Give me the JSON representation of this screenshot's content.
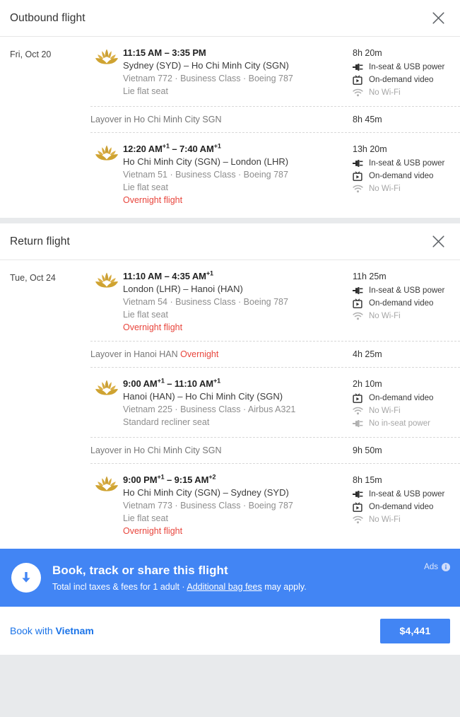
{
  "cards": [
    {
      "title": "Outbound flight",
      "close_icon": "close-icon",
      "date": "Fri, Oct 20",
      "rows": [
        {
          "kind": "segment",
          "logo": "vietnam-airlines-lotus-logo",
          "times": "11:15 AM – 3:35 PM",
          "times_plain": "11:15 AM – 3:35 PM",
          "dep_sup": "",
          "arr_sup": "",
          "route": "Sydney (SYD) – Ho Chi Minh City (SGN)",
          "meta": "Vietnam 772 · Business Class · Boeing 787",
          "seat": "Lie flat seat",
          "overnight": "",
          "duration": "8h 20m",
          "amenities": [
            {
              "icon": "power-plug-icon",
              "label": "In-seat & USB power",
              "available": true
            },
            {
              "icon": "on-demand-video-icon",
              "label": "On-demand video",
              "available": true
            },
            {
              "icon": "wifi-icon",
              "label": "No Wi-Fi",
              "available": false
            }
          ]
        },
        {
          "kind": "layover",
          "text": "Layover in Ho Chi Minh City SGN",
          "overnight": "",
          "duration": "8h 45m"
        },
        {
          "kind": "segment",
          "logo": "vietnam-airlines-lotus-logo",
          "times_plain": "12:20 AM – 7:40 AM",
          "dep_time": "12:20 AM",
          "dep_sup": "+1",
          "arr_time": "7:40 AM",
          "arr_sup": "+1",
          "route": "Ho Chi Minh City (SGN) – London (LHR)",
          "meta": "Vietnam 51 · Business Class · Boeing 787",
          "seat": "Lie flat seat",
          "overnight": "Overnight flight",
          "duration": "13h 20m",
          "amenities": [
            {
              "icon": "power-plug-icon",
              "label": "In-seat & USB power",
              "available": true
            },
            {
              "icon": "on-demand-video-icon",
              "label": "On-demand video",
              "available": true
            },
            {
              "icon": "wifi-icon",
              "label": "No Wi-Fi",
              "available": false
            }
          ]
        }
      ]
    },
    {
      "title": "Return flight",
      "close_icon": "close-icon",
      "date": "Tue, Oct 24",
      "rows": [
        {
          "kind": "segment",
          "logo": "vietnam-airlines-lotus-logo",
          "times_plain": "11:10 AM – 4:35 AM",
          "dep_time": "11:10 AM",
          "dep_sup": "",
          "arr_time": "4:35 AM",
          "arr_sup": "+1",
          "route": "London (LHR) – Hanoi (HAN)",
          "meta": "Vietnam 54 · Business Class · Boeing 787",
          "seat": "Lie flat seat",
          "overnight": "Overnight flight",
          "duration": "11h 25m",
          "amenities": [
            {
              "icon": "power-plug-icon",
              "label": "In-seat & USB power",
              "available": true
            },
            {
              "icon": "on-demand-video-icon",
              "label": "On-demand video",
              "available": true
            },
            {
              "icon": "wifi-icon",
              "label": "No Wi-Fi",
              "available": false
            }
          ]
        },
        {
          "kind": "layover",
          "text": "Layover in Hanoi HAN",
          "overnight": "Overnight",
          "duration": "4h 25m"
        },
        {
          "kind": "segment",
          "logo": "vietnam-airlines-lotus-logo",
          "times_plain": "9:00 AM – 11:10 AM",
          "dep_time": "9:00 AM",
          "dep_sup": "+1",
          "arr_time": "11:10 AM",
          "arr_sup": "+1",
          "route": "Hanoi (HAN) – Ho Chi Minh City (SGN)",
          "meta": "Vietnam 225 · Business Class · Airbus A321",
          "seat": "Standard recliner seat",
          "overnight": "",
          "duration": "2h 10m",
          "amenities": [
            {
              "icon": "on-demand-video-icon",
              "label": "On-demand video",
              "available": true
            },
            {
              "icon": "wifi-icon",
              "label": "No Wi-Fi",
              "available": false
            },
            {
              "icon": "power-plug-icon",
              "label": "No in-seat power",
              "available": false
            }
          ]
        },
        {
          "kind": "layover",
          "text": "Layover in Ho Chi Minh City SGN",
          "overnight": "",
          "duration": "9h 50m"
        },
        {
          "kind": "segment",
          "logo": "vietnam-airlines-lotus-logo",
          "times_plain": "9:00 PM – 9:15 AM",
          "dep_time": "9:00 PM",
          "dep_sup": "+1",
          "arr_time": "9:15 AM",
          "arr_sup": "+2",
          "route": "Ho Chi Minh City (SGN) – Sydney (SYD)",
          "meta": "Vietnam 773 · Business Class · Boeing 787",
          "seat": "Lie flat seat",
          "overnight": "Overnight flight",
          "duration": "8h 15m",
          "amenities": [
            {
              "icon": "power-plug-icon",
              "label": "In-seat & USB power",
              "available": true
            },
            {
              "icon": "on-demand-video-icon",
              "label": "On-demand video",
              "available": true
            },
            {
              "icon": "wifi-icon",
              "label": "No Wi-Fi",
              "available": false
            }
          ]
        }
      ]
    }
  ],
  "banner": {
    "icon": "download-arrow-icon",
    "title": "Book, track or share this flight",
    "subtitle_before": "Total incl taxes & fees for 1 adult · ",
    "subtitle_link": "Additional bag fees",
    "subtitle_after": " may apply.",
    "ads_label": "Ads",
    "ads_info_icon": "info-icon"
  },
  "footer": {
    "book_prefix": "Book with ",
    "book_airline": "Vietnam",
    "price": "$4,441"
  },
  "colors": {
    "accent_blue": "#4285f4",
    "link_blue": "#1a73e8",
    "overnight_red": "#e8453c",
    "lotus_gold": "#d4a02a"
  }
}
